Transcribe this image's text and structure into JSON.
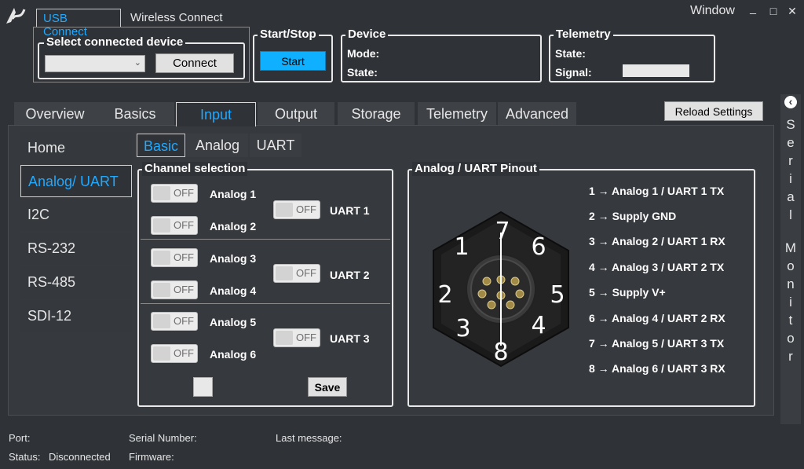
{
  "window": {
    "title": "Window",
    "minimize": "_",
    "maximize": "□",
    "close": "✕"
  },
  "connection_tabs": [
    "USB Connect",
    "Wireless Connect"
  ],
  "select_device": {
    "title": "Select connected device",
    "value": "",
    "connect_label": "Connect"
  },
  "start_stop": {
    "title": "Start/Stop",
    "start_label": "Start"
  },
  "device": {
    "title": "Device",
    "mode_label": "Mode:",
    "state_label": "State:"
  },
  "telemetry": {
    "title": "Telemetry",
    "state_label": "State:",
    "signal_label": "Signal:"
  },
  "main_tabs": [
    "Overview",
    "Basics",
    "Input",
    "Output",
    "Storage",
    "Telemetry",
    "Advanced"
  ],
  "reload_label": "Reload Settings",
  "sidebar": [
    "Home",
    "Analog/ UART",
    "I2C",
    "RS-232",
    "RS-485",
    "SDI-12"
  ],
  "sub_tabs": [
    "Basic",
    "Analog",
    "UART"
  ],
  "channel_selection": {
    "title": "Channel selection",
    "off_text": "OFF",
    "analog": [
      "Analog 1",
      "Analog 2",
      "Analog 3",
      "Analog 4",
      "Analog 5",
      "Analog 6"
    ],
    "uart": [
      "UART 1",
      "UART 2",
      "UART 3"
    ],
    "save_label": "Save"
  },
  "pinout": {
    "title": "Analog / UART Pinout",
    "connector_numbers": [
      "1",
      "2",
      "3",
      "4",
      "5",
      "6",
      "7",
      "8"
    ],
    "rows": [
      "1 → Analog 1 / UART 1 TX",
      "2 → Supply GND",
      "3 → Analog 2 / UART 1 RX",
      "4 → Analog 3 / UART 2 TX",
      "5 → Supply V+",
      "6 → Analog 4 / UART 2 RX",
      "7 → Analog 5 / UART 3 TX",
      "8 → Analog 6 / UART 3 RX"
    ]
  },
  "serial_monitor": {
    "collapse_icon": "‹",
    "letters": [
      "S",
      "e",
      "r",
      "i",
      "a",
      "l",
      "",
      "M",
      "o",
      "n",
      "i",
      "t",
      "o",
      "r"
    ]
  },
  "status_bar": {
    "port_label": "Port:",
    "status_label": "Status:",
    "status_value": "Disconnected",
    "serial_label": "Serial Number:",
    "firmware_label": "Firmware:",
    "last_message_label": "Last message:"
  }
}
